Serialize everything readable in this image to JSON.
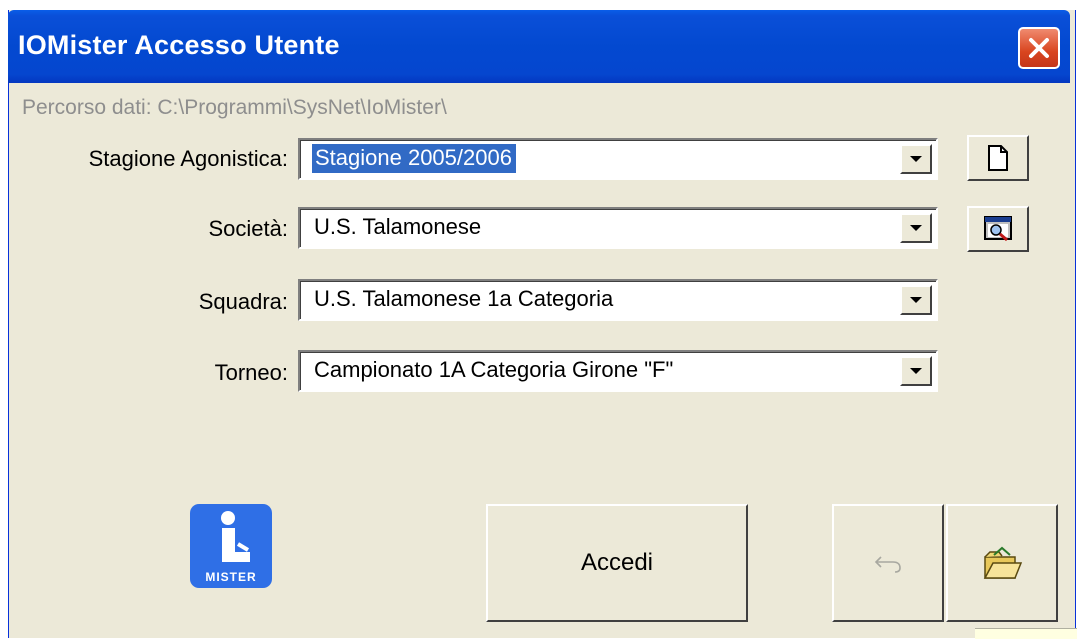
{
  "window": {
    "title": "IOMister Accesso Utente"
  },
  "path": {
    "text": "Percorso dati: C:\\Programmi\\SysNet\\IoMister\\"
  },
  "fields": [
    {
      "label": "Stagione Agonistica:",
      "value": "Stagione 2005/2006",
      "selected": true
    },
    {
      "label": "Società:",
      "value": "U.S. Talamonese"
    },
    {
      "label": "Squadra:",
      "value": "U.S. Talamonese 1a Categoria"
    },
    {
      "label": "Torneo:",
      "value": "Campionato 1A Categoria Girone \"F\""
    }
  ],
  "side_buttons": [
    {
      "icon": "new-document-icon"
    },
    {
      "icon": "search-society-icon"
    }
  ],
  "logo": {
    "text": "MISTER",
    "icon": "iomister-logo"
  },
  "buttons": {
    "accedi_label": "Accedi",
    "undo_icon": "undo-icon",
    "open_icon": "open-folder-icon"
  },
  "colors": {
    "titlebar": "#0349d0",
    "selection": "#316ac5",
    "face": "#ece9d8",
    "close": "#d9451f"
  }
}
